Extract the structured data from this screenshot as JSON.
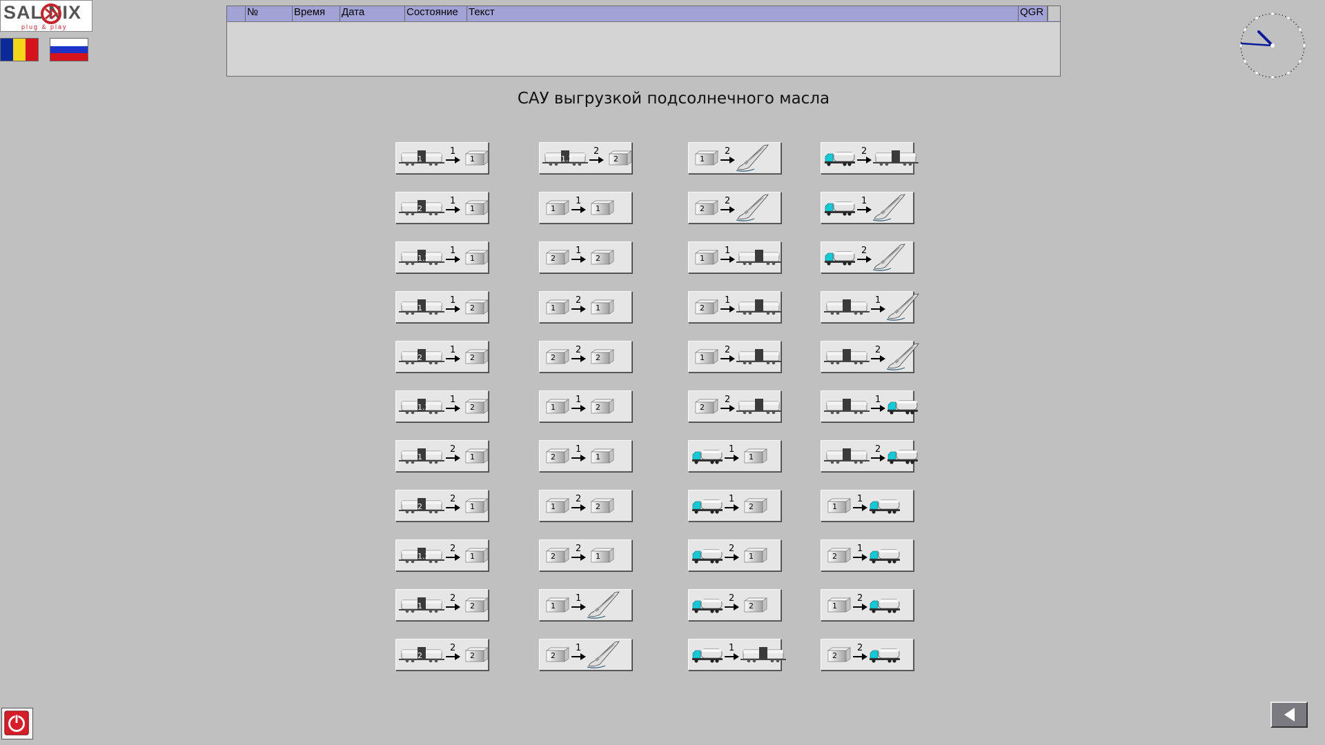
{
  "logo": {
    "brand": "SAL NIX",
    "slogan": "plug & play"
  },
  "flags": {
    "ro": [
      "#0a2a9a",
      "#f3d51a",
      "#d4131c"
    ],
    "ru": [
      "#ffffff",
      "#1e33c8",
      "#d4131c"
    ]
  },
  "alarm_table": {
    "columns": [
      "№",
      "Время",
      "Дата",
      "Состояние",
      "Текст",
      "QGR"
    ]
  },
  "title": "САУ выгрузкой подсолнечного масла",
  "routes": [
    [
      {
        "src": {
          "type": "railcar",
          "label": "1"
        },
        "line": "1",
        "dst": {
          "type": "tank",
          "label": "1"
        }
      },
      {
        "src": {
          "type": "railcar",
          "label": "2"
        },
        "line": "1",
        "dst": {
          "type": "tank",
          "label": "1"
        }
      },
      {
        "src": {
          "type": "railcar",
          "label": "1.2"
        },
        "line": "1",
        "dst": {
          "type": "tank",
          "label": "1"
        }
      },
      {
        "src": {
          "type": "railcar",
          "label": "1"
        },
        "line": "1",
        "dst": {
          "type": "tank",
          "label": "2"
        }
      },
      {
        "src": {
          "type": "railcar",
          "label": "2"
        },
        "line": "1",
        "dst": {
          "type": "tank",
          "label": "2"
        }
      },
      {
        "src": {
          "type": "railcar",
          "label": "1.2"
        },
        "line": "1",
        "dst": {
          "type": "tank",
          "label": "2"
        }
      },
      {
        "src": {
          "type": "railcar",
          "label": "1"
        },
        "line": "2",
        "dst": {
          "type": "tank",
          "label": "1"
        }
      },
      {
        "src": {
          "type": "railcar",
          "label": "2"
        },
        "line": "2",
        "dst": {
          "type": "tank",
          "label": "1"
        }
      },
      {
        "src": {
          "type": "railcar",
          "label": "1.2"
        },
        "line": "2",
        "dst": {
          "type": "tank",
          "label": "1"
        }
      },
      {
        "src": {
          "type": "railcar",
          "label": "1"
        },
        "line": "2",
        "dst": {
          "type": "tank",
          "label": "2"
        }
      },
      {
        "src": {
          "type": "railcar",
          "label": "2"
        },
        "line": "2",
        "dst": {
          "type": "tank",
          "label": "2"
        }
      }
    ],
    [
      {
        "src": {
          "type": "railcar",
          "label": "1.2"
        },
        "line": "2",
        "dst": {
          "type": "tank",
          "label": "2"
        }
      },
      {
        "src": {
          "type": "tank",
          "label": "1"
        },
        "line": "1",
        "dst": {
          "type": "tank",
          "label": "1"
        }
      },
      {
        "src": {
          "type": "tank",
          "label": "2"
        },
        "line": "1",
        "dst": {
          "type": "tank",
          "label": "2"
        }
      },
      {
        "src": {
          "type": "tank",
          "label": "1"
        },
        "line": "2",
        "dst": {
          "type": "tank",
          "label": "1"
        }
      },
      {
        "src": {
          "type": "tank",
          "label": "2"
        },
        "line": "2",
        "dst": {
          "type": "tank",
          "label": "2"
        }
      },
      {
        "src": {
          "type": "tank",
          "label": "1"
        },
        "line": "1",
        "dst": {
          "type": "tank",
          "label": "2"
        }
      },
      {
        "src": {
          "type": "tank",
          "label": "2"
        },
        "line": "1",
        "dst": {
          "type": "tank",
          "label": "1"
        }
      },
      {
        "src": {
          "type": "tank",
          "label": "1"
        },
        "line": "2",
        "dst": {
          "type": "tank",
          "label": "2"
        }
      },
      {
        "src": {
          "type": "tank",
          "label": "2"
        },
        "line": "2",
        "dst": {
          "type": "tank",
          "label": "1"
        }
      },
      {
        "src": {
          "type": "tank",
          "label": "1"
        },
        "line": "1",
        "dst": {
          "type": "ship",
          "label": ""
        }
      },
      {
        "src": {
          "type": "tank",
          "label": "2"
        },
        "line": "1",
        "dst": {
          "type": "ship",
          "label": ""
        }
      }
    ],
    [
      {
        "src": {
          "type": "tank",
          "label": "1"
        },
        "line": "2",
        "dst": {
          "type": "ship",
          "label": ""
        }
      },
      {
        "src": {
          "type": "tank",
          "label": "2"
        },
        "line": "2",
        "dst": {
          "type": "ship",
          "label": ""
        }
      },
      {
        "src": {
          "type": "tank",
          "label": "1"
        },
        "line": "1",
        "dst": {
          "type": "railcar",
          "label": ""
        }
      },
      {
        "src": {
          "type": "tank",
          "label": "2"
        },
        "line": "1",
        "dst": {
          "type": "railcar",
          "label": ""
        }
      },
      {
        "src": {
          "type": "tank",
          "label": "1"
        },
        "line": "2",
        "dst": {
          "type": "railcar",
          "label": ""
        }
      },
      {
        "src": {
          "type": "tank",
          "label": "2"
        },
        "line": "2",
        "dst": {
          "type": "railcar",
          "label": ""
        }
      },
      {
        "src": {
          "type": "truck",
          "label": ""
        },
        "line": "1",
        "dst": {
          "type": "tank",
          "label": "1"
        }
      },
      {
        "src": {
          "type": "truck",
          "label": ""
        },
        "line": "1",
        "dst": {
          "type": "tank",
          "label": "2"
        }
      },
      {
        "src": {
          "type": "truck",
          "label": ""
        },
        "line": "2",
        "dst": {
          "type": "tank",
          "label": "1"
        }
      },
      {
        "src": {
          "type": "truck",
          "label": ""
        },
        "line": "2",
        "dst": {
          "type": "tank",
          "label": "2"
        }
      },
      {
        "src": {
          "type": "truck",
          "label": ""
        },
        "line": "1",
        "dst": {
          "type": "railcar",
          "label": ""
        }
      }
    ],
    [
      {
        "src": {
          "type": "truck",
          "label": ""
        },
        "line": "2",
        "dst": {
          "type": "railcar",
          "label": ""
        }
      },
      {
        "src": {
          "type": "truck",
          "label": ""
        },
        "line": "1",
        "dst": {
          "type": "ship",
          "label": ""
        }
      },
      {
        "src": {
          "type": "truck",
          "label": ""
        },
        "line": "2",
        "dst": {
          "type": "ship",
          "label": ""
        }
      },
      {
        "src": {
          "type": "railcar",
          "label": ""
        },
        "line": "1",
        "dst": {
          "type": "ship",
          "label": ""
        }
      },
      {
        "src": {
          "type": "railcar",
          "label": ""
        },
        "line": "2",
        "dst": {
          "type": "ship",
          "label": ""
        }
      },
      {
        "src": {
          "type": "railcar",
          "label": ""
        },
        "line": "1",
        "dst": {
          "type": "truck",
          "label": ""
        }
      },
      {
        "src": {
          "type": "railcar",
          "label": ""
        },
        "line": "2",
        "dst": {
          "type": "truck",
          "label": ""
        }
      },
      {
        "src": {
          "type": "tank",
          "label": "1"
        },
        "line": "1",
        "dst": {
          "type": "truck",
          "label": ""
        }
      },
      {
        "src": {
          "type": "tank",
          "label": "2"
        },
        "line": "1",
        "dst": {
          "type": "truck",
          "label": ""
        }
      },
      {
        "src": {
          "type": "tank",
          "label": "1"
        },
        "line": "2",
        "dst": {
          "type": "truck",
          "label": ""
        }
      },
      {
        "src": {
          "type": "tank",
          "label": "2"
        },
        "line": "2",
        "dst": {
          "type": "truck",
          "label": ""
        }
      }
    ]
  ],
  "colors": {
    "background": "#c0c0c0",
    "header": "#a2a2d6",
    "truck_cab": "#16c9d6",
    "clock_hands": "#0a1a9a",
    "power_button": "#d41e2a"
  },
  "icons": {
    "power": "power-icon",
    "back": "triangle-left-icon",
    "clock": "analog-clock-icon"
  }
}
